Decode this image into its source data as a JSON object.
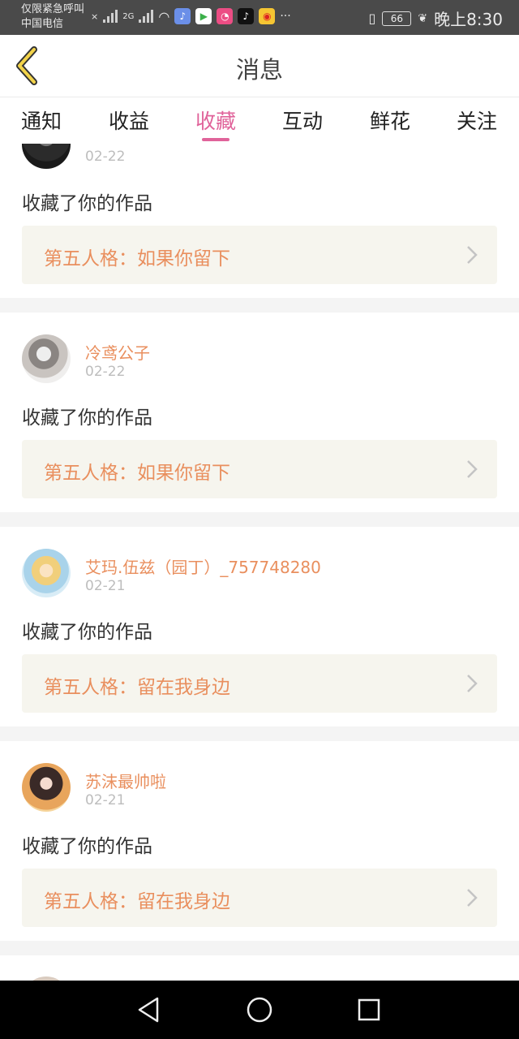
{
  "status_bar": {
    "line1": "仅限紧急呼叫",
    "line2": "中国电信",
    "net_type": "2G",
    "battery": "66",
    "time": "晚上8:30",
    "more": "···"
  },
  "header": {
    "title": "消息"
  },
  "tabs": [
    {
      "label": "通知"
    },
    {
      "label": "收益"
    },
    {
      "label": "收藏"
    },
    {
      "label": "互动"
    },
    {
      "label": "鲜花"
    },
    {
      "label": "关注"
    }
  ],
  "active_tab": "收藏",
  "items": [
    {
      "name": "",
      "date": "02-22",
      "action": "收藏了你的作品",
      "work": "第五人格：如果你留下"
    },
    {
      "name": "冷鸢公子",
      "date": "02-22",
      "action": "收藏了你的作品",
      "work": "第五人格：如果你留下"
    },
    {
      "name": "艾玛.伍兹（园丁）_757748280",
      "date": "02-21",
      "action": "收藏了你的作品",
      "work": "第五人格：留在我身边"
    },
    {
      "name": "苏沫最帅啦",
      "date": "02-21",
      "action": "收藏了你的作品",
      "work": "第五人格：留在我身边"
    }
  ],
  "colors": {
    "accent": "#e0639a",
    "username": "#e98f5e",
    "work_bg": "#f6f5ee",
    "status_bar": "#4a4a4a"
  },
  "icons": {
    "back": "chevron-left-icon",
    "chevron": "chevron-right-icon",
    "nav": [
      "back-triangle-icon",
      "home-circle-icon",
      "recents-square-icon"
    ]
  }
}
